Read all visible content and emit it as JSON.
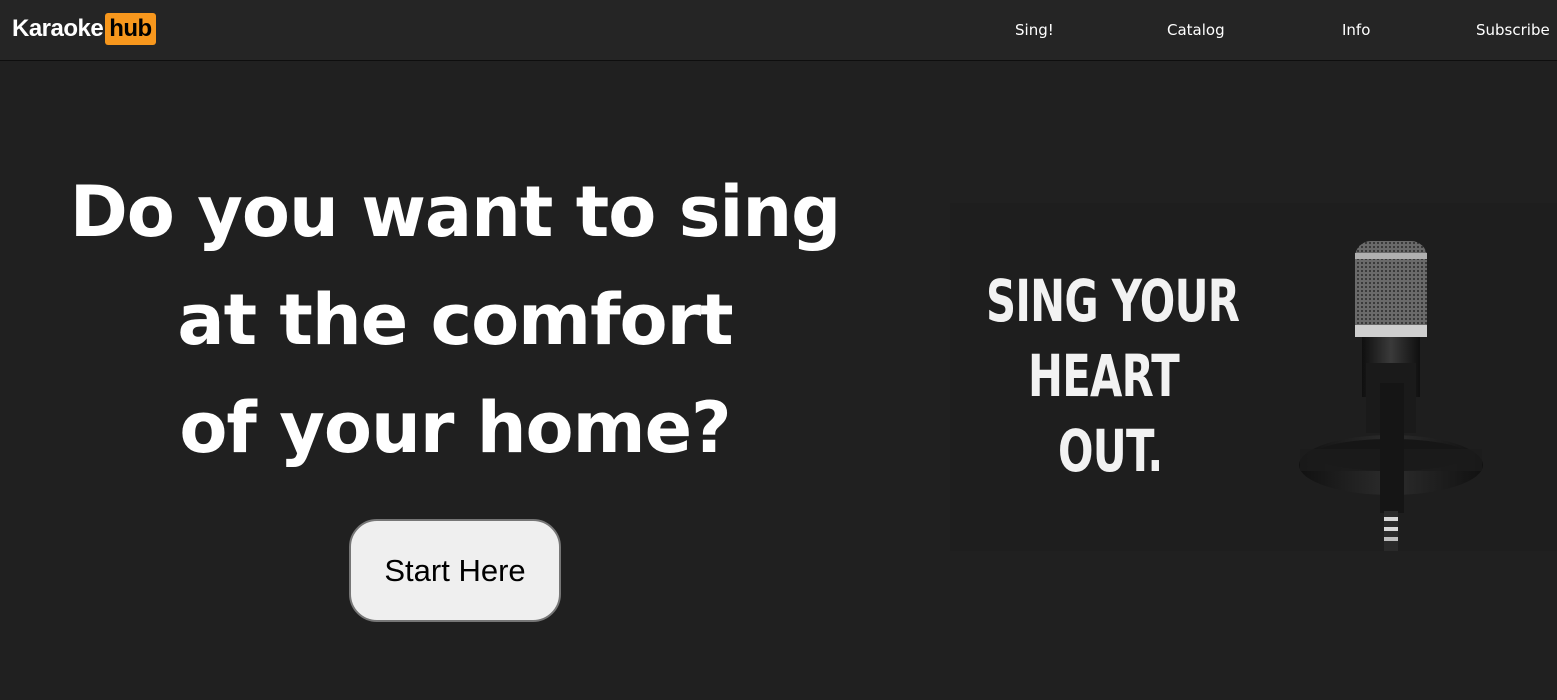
{
  "header": {
    "logo": {
      "main": "Karaoke",
      "badge": "hub",
      "badge_color": "#f7971d"
    },
    "nav": [
      {
        "label": "Sing!"
      },
      {
        "label": "Catalog"
      },
      {
        "label": "Info"
      },
      {
        "label": "Subscribe"
      }
    ]
  },
  "hero": {
    "headline_lines": [
      "Do you want to sing",
      "at the comfort",
      "of your home?"
    ],
    "cta_label": "Start Here",
    "image": {
      "text_lines": [
        "SING YOUR",
        "HEART",
        "OUT."
      ],
      "icon": "microphone-icon"
    }
  },
  "colors": {
    "background": "#202020",
    "topbar": "#252525",
    "accent": "#f7971d",
    "button_bg": "#efefef"
  }
}
